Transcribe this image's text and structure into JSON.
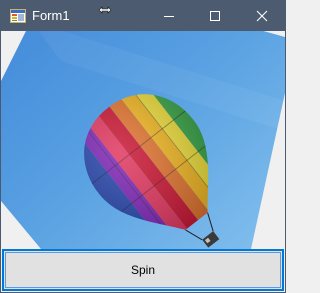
{
  "window": {
    "title": "Form1",
    "titlebar_color": "#4c5b6f",
    "app_icon": "winforms-app-icon",
    "controls": {
      "minimize_icon": "minimize-icon",
      "maximize_icon": "maximize-icon",
      "close_icon": "close-icon"
    },
    "cursor_icon": "resize-horizontal-cursor-icon"
  },
  "picture": {
    "image": "hot-air-balloon-rotated-photo",
    "sky_color": "#5a9fdd"
  },
  "spin_button": {
    "label": "Spin",
    "focus_color": "#0078d7"
  }
}
